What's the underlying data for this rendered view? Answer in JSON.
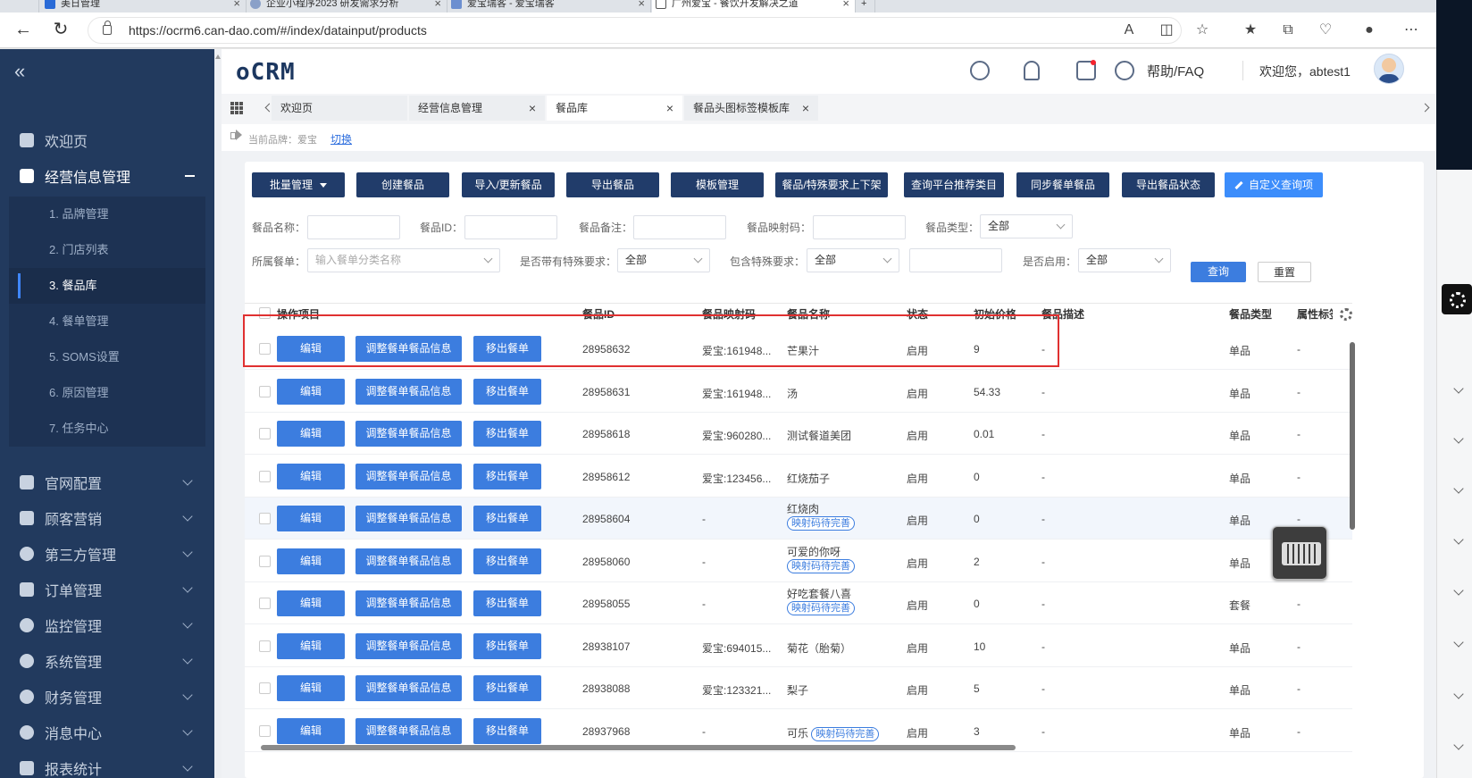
{
  "browser": {
    "tabs": [
      {
        "title": "美日管理"
      },
      {
        "title": "企业小程序2023 研发需求分析"
      },
      {
        "title": "爱宝瑞客 - 爱宝瑞客"
      },
      {
        "title": "广州爱宝 - 餐饮开发解决之道"
      }
    ],
    "url": "https://ocrm6.can-dao.com/#/index/datainput/products"
  },
  "sidebar": {
    "items": [
      {
        "label": "欢迎页",
        "icon": "home-icon"
      },
      {
        "label": "经营信息管理",
        "icon": "store-icon",
        "expanded": true
      },
      {
        "label": "官网配置",
        "icon": "website-icon"
      },
      {
        "label": "顾客营销",
        "icon": "gift-icon"
      },
      {
        "label": "第三方管理",
        "icon": "share-icon"
      },
      {
        "label": "订单管理",
        "icon": "clipboard-icon"
      },
      {
        "label": "监控管理",
        "icon": "monitor-icon"
      },
      {
        "label": "系统管理",
        "icon": "gear-icon"
      },
      {
        "label": "财务管理",
        "icon": "money-icon"
      },
      {
        "label": "消息中心",
        "icon": "chat-icon"
      },
      {
        "label": "报表统计",
        "icon": "report-icon"
      }
    ],
    "submenu": [
      {
        "label": "1. 品牌管理"
      },
      {
        "label": "2. 门店列表"
      },
      {
        "label": "3. 餐品库",
        "active": true
      },
      {
        "label": "4. 餐单管理"
      },
      {
        "label": "5. SOMS设置"
      },
      {
        "label": "6. 原因管理"
      },
      {
        "label": "7. 任务中心"
      }
    ]
  },
  "header": {
    "logo": "oCRM",
    "help": "帮助/FAQ",
    "welcome": "欢迎您，abtest1"
  },
  "page_tabs": [
    {
      "label": "欢迎页"
    },
    {
      "label": "经营信息管理"
    },
    {
      "label": "餐品库",
      "active": true
    },
    {
      "label": "餐品头图标签模板库"
    }
  ],
  "brand_line": {
    "label": "当前品牌：爱宝",
    "switch": "切换"
  },
  "toolbar": {
    "buttons": [
      {
        "label": "批量管理"
      },
      {
        "label": "创建餐品"
      },
      {
        "label": "导入/更新餐品"
      },
      {
        "label": "导出餐品"
      },
      {
        "label": "模板管理"
      },
      {
        "label": "餐品/特殊要求上下架"
      },
      {
        "label": "查询平台推荐类目"
      },
      {
        "label": "同步餐单餐品"
      },
      {
        "label": "导出餐品状态"
      },
      {
        "label": "自定义查询项"
      }
    ]
  },
  "filters": {
    "name_label": "餐品名称：",
    "id_label": "餐品ID：",
    "remark_label": "餐品备注：",
    "mapping_label": "餐品映射码：",
    "type_label": "餐品类型：",
    "type_value": "全部",
    "menu_label": "所属餐单：",
    "menu_placeholder": "输入餐单分类名称",
    "has_special_label": "是否带有特殊要求：",
    "has_special_value": "全部",
    "include_special_label": "包含特殊要求：",
    "include_special_value": "全部",
    "enabled_label": "是否启用：",
    "enabled_value": "全部",
    "query": "查询",
    "reset": "重置"
  },
  "table": {
    "columns": [
      "操作项目",
      "餐品ID",
      "餐品映射码",
      "餐品名称",
      "状态",
      "初始价格",
      "餐品描述",
      "餐品类型",
      "属性标签"
    ],
    "actions": {
      "edit": "编辑",
      "adjust": "调整餐单餐品信息",
      "remove": "移出餐单"
    },
    "tag_label": "映射码待完善",
    "rows": [
      {
        "id": "28958632",
        "mapping": "爱宝:161948...",
        "name": "芒果汁",
        "tag": false,
        "status": "启用",
        "price": "9",
        "desc": "-",
        "type": "单品",
        "attr": "-"
      },
      {
        "id": "28958631",
        "mapping": "爱宝:161948...",
        "name": "汤",
        "tag": false,
        "status": "启用",
        "price": "54.33",
        "desc": "-",
        "type": "单品",
        "attr": "-"
      },
      {
        "id": "28958618",
        "mapping": "爱宝:960280...",
        "name": "测试餐道美团",
        "tag": false,
        "status": "启用",
        "price": "0.01",
        "desc": "-",
        "type": "单品",
        "attr": "-"
      },
      {
        "id": "28958612",
        "mapping": "爱宝:123456...",
        "name": "红烧茄子",
        "tag": false,
        "status": "启用",
        "price": "0",
        "desc": "-",
        "type": "单品",
        "attr": "-"
      },
      {
        "id": "28958604",
        "mapping": "-",
        "name": "红烧肉",
        "tag": true,
        "status": "启用",
        "price": "0",
        "desc": "-",
        "type": "单品",
        "attr": "-"
      },
      {
        "id": "28958060",
        "mapping": "-",
        "name": "可爱的你呀",
        "tag": true,
        "status": "启用",
        "price": "2",
        "desc": "-",
        "type": "单品",
        "attr": "-"
      },
      {
        "id": "28958055",
        "mapping": "-",
        "name": "好吃套餐八喜",
        "tag": true,
        "status": "启用",
        "price": "0",
        "desc": "-",
        "type": "套餐",
        "attr": "-"
      },
      {
        "id": "28938107",
        "mapping": "爱宝:694015...",
        "name": "菊花（胎菊）",
        "tag": false,
        "status": "启用",
        "price": "10",
        "desc": "-",
        "type": "单品",
        "attr": "-"
      },
      {
        "id": "28938088",
        "mapping": "爱宝:123321...",
        "name": "梨子",
        "tag": false,
        "status": "启用",
        "price": "5",
        "desc": "-",
        "type": "单品",
        "attr": "-"
      },
      {
        "id": "28937968",
        "mapping": "-",
        "name": "可乐",
        "tag": true,
        "status": "启用",
        "price": "3",
        "desc": "-",
        "type": "单品",
        "attr": "-"
      }
    ]
  },
  "colors": {
    "sidebar_bg": "#223a5e",
    "toolbar_button": "#213c6a",
    "action_button": "#3c7ddf",
    "highlight_border": "#e03131"
  }
}
